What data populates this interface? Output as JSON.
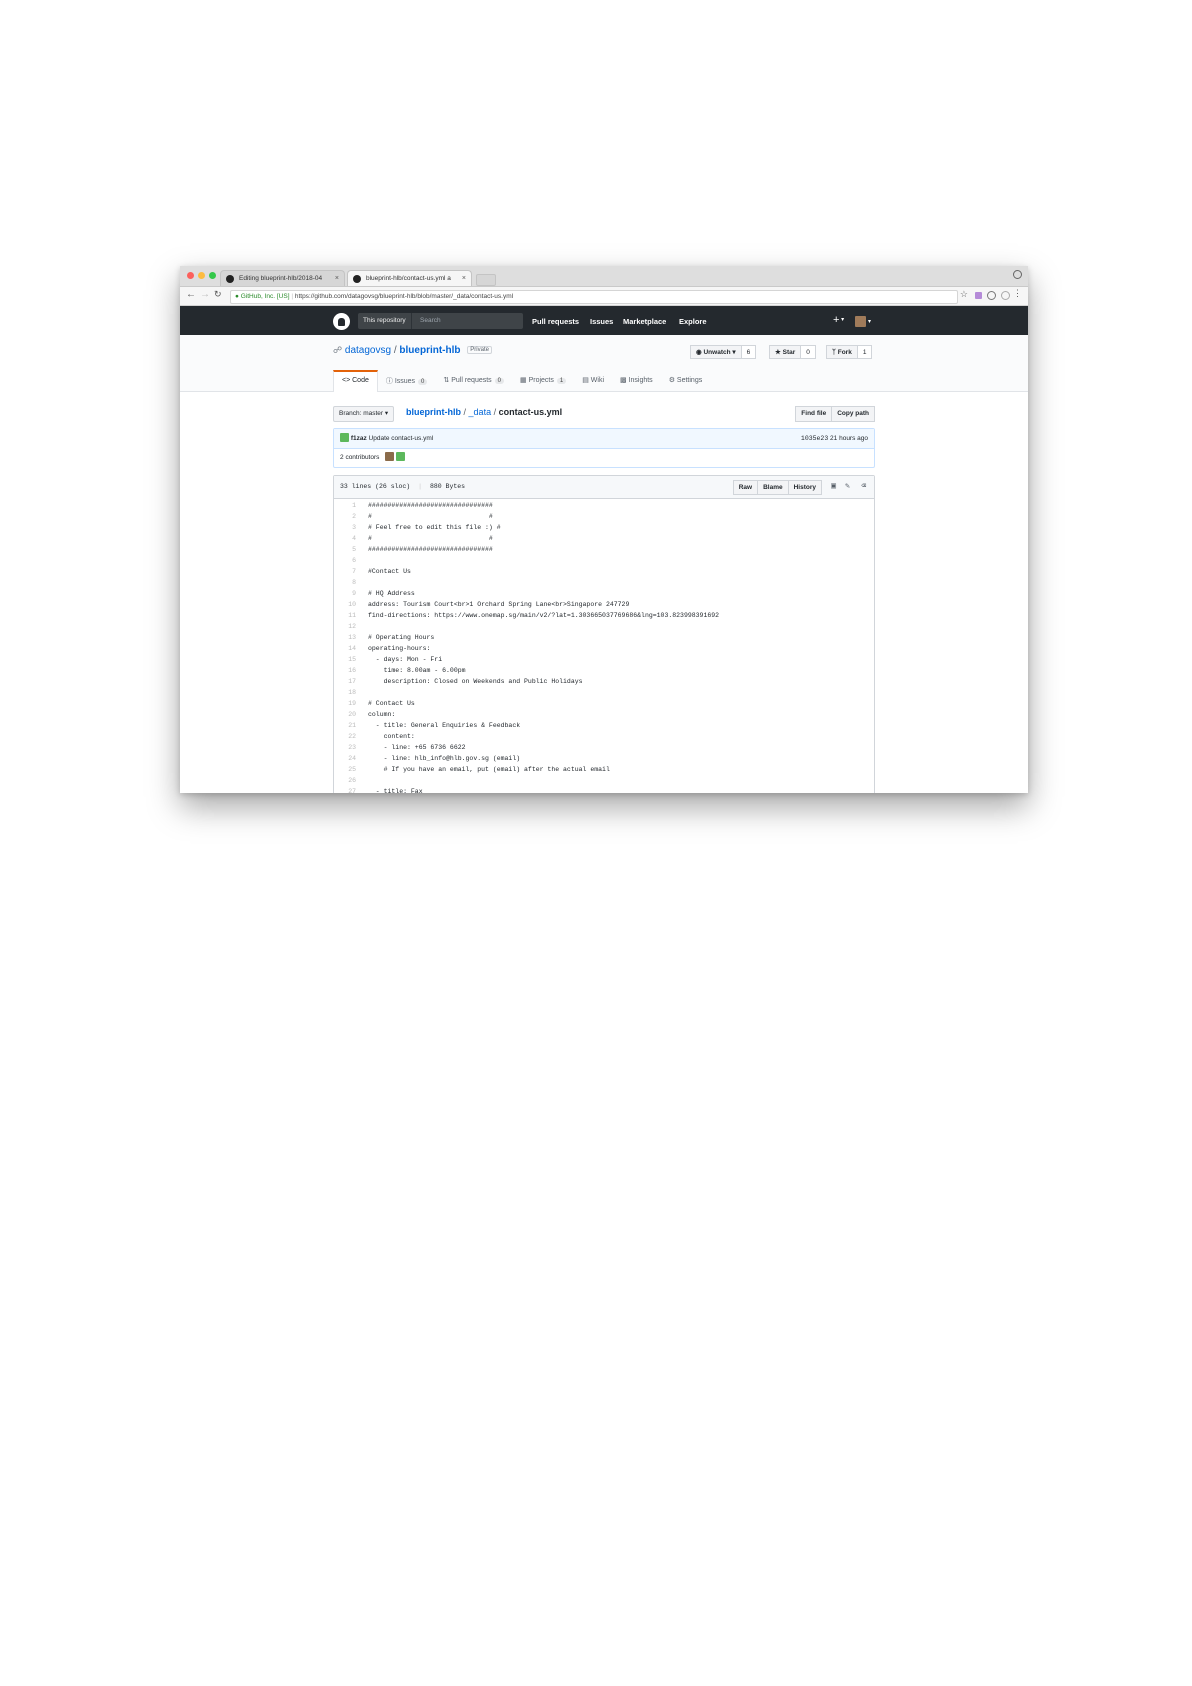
{
  "browser": {
    "tabs": [
      {
        "label": "Editing blueprint-hlb/2018-04",
        "active": false
      },
      {
        "label": "blueprint-hlb/contact-us.yml a",
        "active": true
      }
    ],
    "secure_label": "GitHub, Inc. [US]",
    "url": "https://github.com/datagovsg/blueprint-hlb/blob/master/_data/contact-us.yml"
  },
  "github_header": {
    "scope": "This repository",
    "search_placeholder": "Search",
    "nav": [
      "Pull requests",
      "Issues",
      "Marketplace",
      "Explore"
    ]
  },
  "repo": {
    "owner": "datagovsg",
    "separator": "/",
    "name": "blueprint-hlb",
    "visibility": "Private",
    "unwatch_label": "Unwatch",
    "unwatch_count": "6",
    "star_label": "Star",
    "star_count": "0",
    "fork_label": "Fork",
    "fork_count": "1",
    "tabs": [
      {
        "label": "Code",
        "count": ""
      },
      {
        "label": "Issues",
        "count": "0"
      },
      {
        "label": "Pull requests",
        "count": "0"
      },
      {
        "label": "Projects",
        "count": "1"
      },
      {
        "label": "Wiki",
        "count": ""
      },
      {
        "label": "Insights",
        "count": ""
      },
      {
        "label": "Settings",
        "count": ""
      }
    ]
  },
  "breadcrumb": {
    "branch_label": "Branch: master",
    "repo_link": "blueprint-hlb",
    "dir_link": "_data",
    "file": "contact-us.yml",
    "sep": "/",
    "find_file": "Find file",
    "copy_path": "Copy path"
  },
  "commit": {
    "author": "f1zaz",
    "message": "Update contact-us.yml",
    "sha": "1035e23",
    "time": "21 hours ago",
    "contributors_count": "2",
    "contributors_label": "contributors"
  },
  "file": {
    "lines_info": "33 lines (26 sloc)",
    "size": "880 Bytes",
    "raw": "Raw",
    "blame": "Blame",
    "history": "History",
    "lines": [
      "################################",
      "#                              #",
      "# Feel free to edit this file :) #",
      "#                              #",
      "################################",
      "",
      "#Contact Us",
      "",
      "# HQ Address",
      "address: Tourism Court<br>1 Orchard Spring Lane<br>Singapore 247729",
      "find-directions: https://www.onemap.sg/main/v2/?lat=1.303665037769686&lng=103.823998391692",
      "",
      "# Operating Hours",
      "operating-hours:",
      "  - days: Mon - Fri",
      "    time: 8.00am - 6.00pm",
      "    description: Closed on Weekends and Public Holidays",
      "",
      "# Contact Us",
      "column:",
      "  - title: General Enquiries & Feedback",
      "    content:",
      "    - line: +65 6736 6622",
      "    - line: hlb_info@hlb.gov.sg (email)",
      "    # If you have an email, put (email) after the actual email",
      "",
      "  - title: Fax"
    ]
  }
}
